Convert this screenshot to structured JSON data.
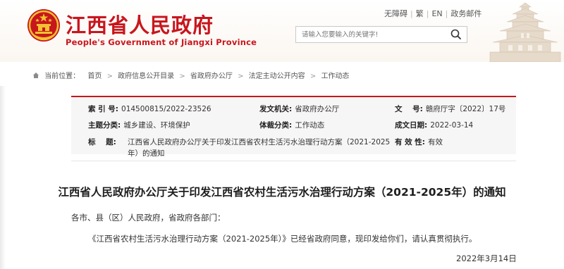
{
  "header": {
    "site_title": "江西省人民政府",
    "site_subtitle": "People's Government of Jiangxi Province",
    "top_links": [
      "无障碍",
      "繁",
      "EN",
      "政务邮件"
    ],
    "search_placeholder": "请输入您要输入的关键字!"
  },
  "breadcrumb": {
    "label": "当前位置：",
    "items": [
      "首页",
      "政府信息公开目录",
      "省政府办公厅",
      "法定主动公开内容",
      "工作动态"
    ]
  },
  "meta": {
    "index_label": "索 引 号:",
    "index_value": "014500815/2022-23526",
    "issuer_label": "发文机关:",
    "issuer_value": "省政府办公厅",
    "docno_label": "文    号:",
    "docno_value": "赣府厅字〔2022〕17号",
    "topic_label": "主题分类:",
    "topic_value": "城乡建设、环境保护",
    "category_label": "体裁分类:",
    "category_value": "工作动态",
    "date_label": "成文日期:",
    "date_value": "2022-03-14",
    "title_label": "标    题:",
    "title_value_line1": "江西省人民政府办公厅关于印发江西省农村生活污水治理行动方案（2021-2025",
    "title_value_line2": "年）的通知",
    "validity_label": "有 效 性:",
    "validity_value": "有效"
  },
  "article": {
    "title": "江西省人民政府办公厅关于印发江西省农村生活污水治理行动方案（2021-2025年）的通知",
    "salutation": "各市、县（区）人民政府，省政府各部门：",
    "body": "《江西省农村生活污水治理行动方案（2021-2025年）》已经省政府同意，现印发给你们，请认真贯彻执行。",
    "date": "2022年3月14日"
  },
  "colors": {
    "brand_red": "#c8161d",
    "meta_bg": "#f6f6f6"
  }
}
